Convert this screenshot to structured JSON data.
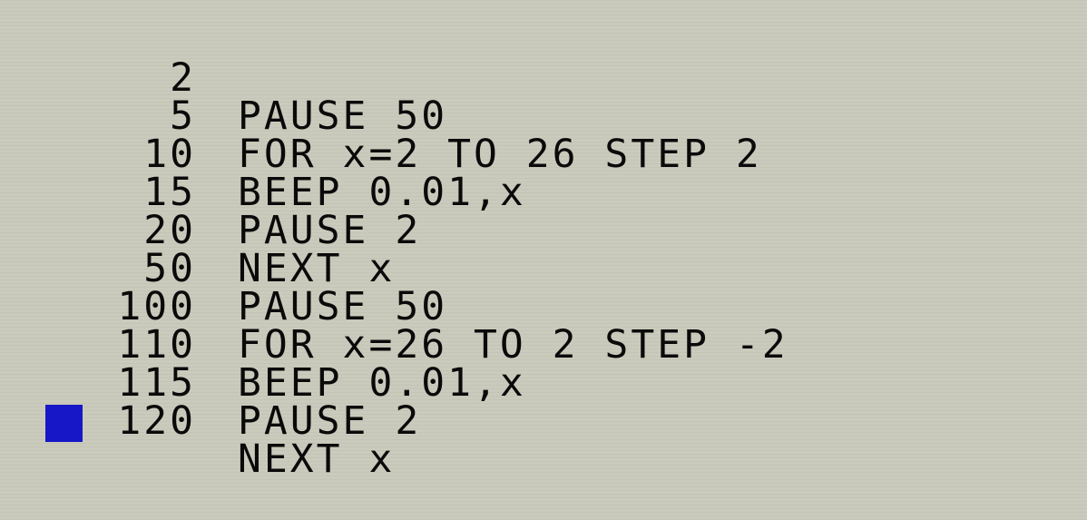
{
  "screen": {
    "lines": [
      {
        "num": "2",
        "code": "PAUSE 50"
      },
      {
        "num": "5",
        "code": "FOR x=2 TO 26 STEP 2"
      },
      {
        "num": "10",
        "code": "BEEP 0.01,x"
      },
      {
        "num": "15",
        "code": "PAUSE 2"
      },
      {
        "num": "20",
        "code": "NEXT x"
      },
      {
        "num": "50",
        "code": "PAUSE 50"
      },
      {
        "num": "100",
        "code": "FOR x=26 TO 2 STEP -2"
      },
      {
        "num": "110",
        "code": "BEEP 0.01,x"
      },
      {
        "num": "115",
        "code": "PAUSE 2"
      },
      {
        "num": "120",
        "code": "NEXT x"
      }
    ],
    "cursor_color": "#1717c7",
    "background_color": "#cbcbbd"
  }
}
